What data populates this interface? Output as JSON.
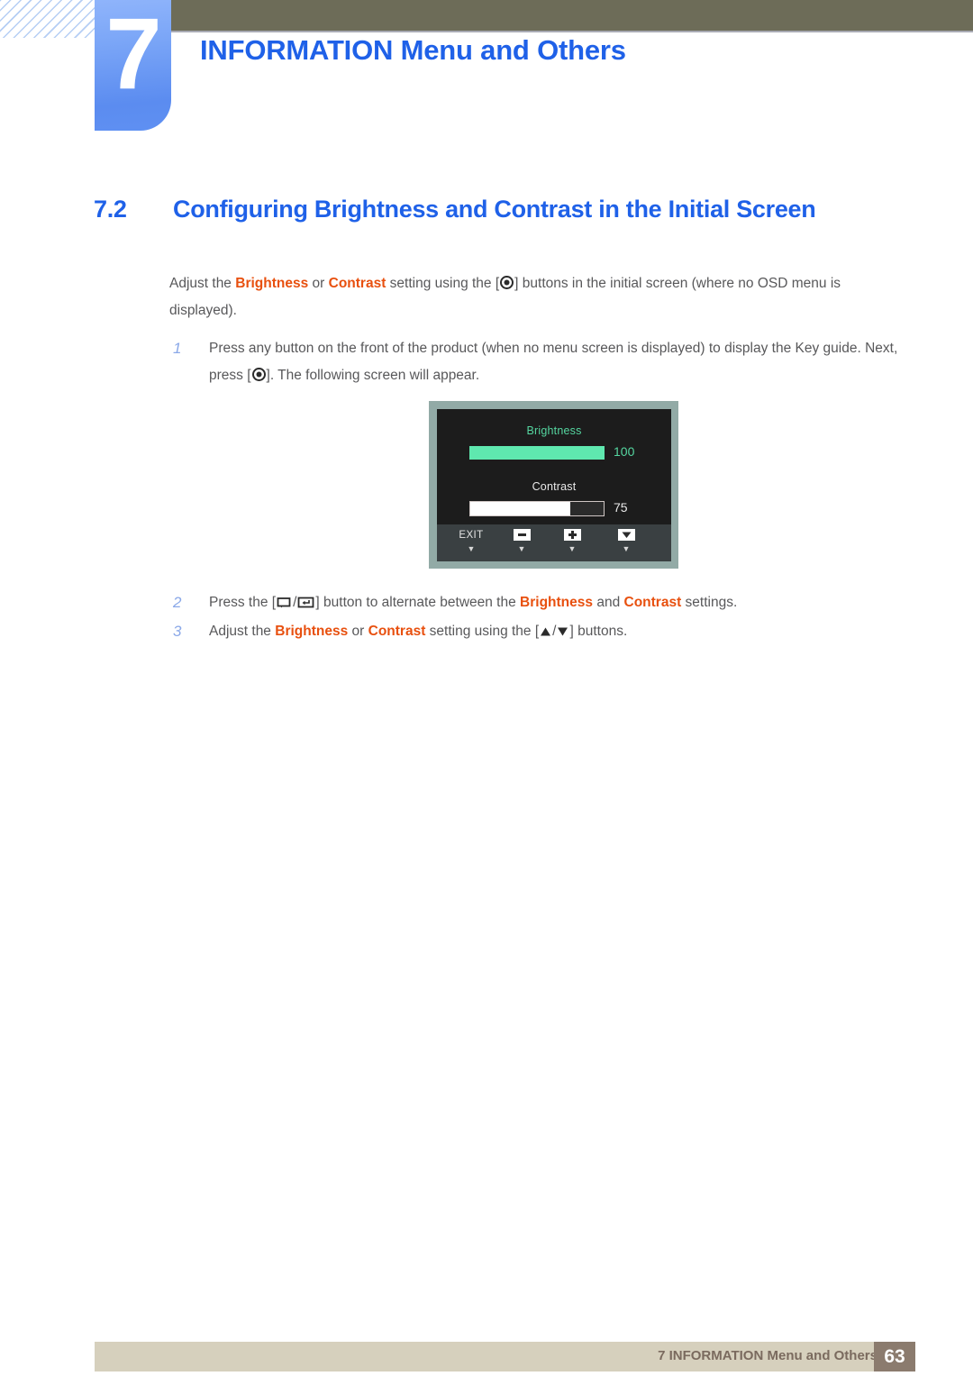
{
  "chapter": {
    "number": "7",
    "title": "INFORMATION Menu and Others"
  },
  "section": {
    "number": "7.2",
    "title": "Configuring Brightness and Contrast in the Initial Screen"
  },
  "intro": {
    "part1": "Adjust the ",
    "kw1": "Brightness",
    "part2": " or ",
    "kw2": "Contrast",
    "part3": " setting using the [",
    "part4": "] buttons in the initial screen (where no OSD menu is displayed)."
  },
  "steps": [
    {
      "num": "1",
      "part1": "Press any button on the front of the product (when no menu screen is displayed) to display the Key guide. Next, press [",
      "part2": "]. The following screen will appear."
    },
    {
      "num": "2",
      "part1": "Press the [",
      "part2": "] button to alternate between the ",
      "kw1": "Brightness",
      "part3": " and ",
      "kw2": "Contrast",
      "part4": " settings."
    },
    {
      "num": "3",
      "part1": "Adjust the ",
      "kw1": "Brightness",
      "part2": " or ",
      "kw2": "Contrast",
      "part3": " setting using the [",
      "part4": "] buttons."
    }
  ],
  "osd": {
    "brightness_label": "Brightness",
    "brightness_value": "100",
    "brightness_percent": 100,
    "contrast_label": "Contrast",
    "contrast_value": "75",
    "contrast_percent": 75,
    "toolbar": [
      {
        "label": "EXIT",
        "icon": "exit-label",
        "caret": "▼"
      },
      {
        "label": "",
        "icon": "minus-key-icon",
        "caret": "▼"
      },
      {
        "label": "",
        "icon": "plus-key-icon",
        "caret": "▼"
      },
      {
        "label": "",
        "icon": "down-arrow-key-icon",
        "caret": "▼"
      }
    ],
    "colors": {
      "bezel": "#92aaa6",
      "screen": "#1c1c1c",
      "green": "#5fe8af",
      "toolbar": "#3a4042"
    }
  },
  "footer": {
    "text": "7 INFORMATION Menu and Others",
    "page": "63"
  },
  "colors": {
    "accent_blue": "#1f61e8",
    "keyword_orange": "#e8500f",
    "header_olive": "#6d6c58",
    "footer_band": "#d6d0bd",
    "footer_page_box": "#8b7b6e"
  }
}
